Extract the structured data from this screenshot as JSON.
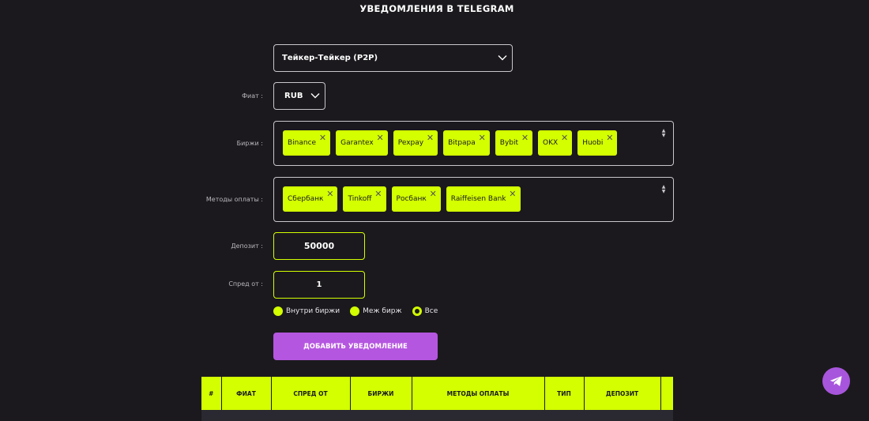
{
  "header": {
    "title": "УВЕДОМЛЕНИЯ В TELEGRAM"
  },
  "mode_select": {
    "value": "Тейкер-Тейкер (P2P)"
  },
  "fiat": {
    "label": "Фиат :",
    "value": "RUB"
  },
  "exchanges": {
    "label": "Биржи :",
    "tags": [
      "Binance",
      "Garantex",
      "Pexpay",
      "Bitpapa",
      "Bybit",
      "OKX",
      "Huobi"
    ]
  },
  "payment_methods": {
    "label": "Методы оплаты :",
    "tags": [
      "Сбербанк",
      "Tinkoff",
      "Росбанк",
      "Raiffeisen Bank"
    ]
  },
  "deposit": {
    "label": "Депозит :",
    "value": "50000"
  },
  "spread": {
    "label": "Спред от :",
    "value": "1"
  },
  "scope": {
    "options": [
      "Внутри биржи",
      "Меж бирж",
      "Все"
    ],
    "selected": "Все"
  },
  "add_button": {
    "label": "ДОБАВИТЬ УВЕДОМЛЕНИЕ"
  },
  "table": {
    "columns": [
      "#",
      "ФИАТ",
      "СПРЕД ОТ",
      "БИРЖИ",
      "МЕТОДЫ ОПЛАТЫ",
      "ТИП",
      "ДЕПОЗИТ",
      ""
    ]
  },
  "colors": {
    "background": "#1b191d",
    "accent_lime": "#d3ff00",
    "accent_purple": "#b556e0",
    "border": "#c9c6cc"
  },
  "icons": {
    "select_chevron": "chevron-down-icon",
    "tag_remove": "close-icon",
    "list_toggle": "updown-arrows-icon",
    "fab": "telegram-icon"
  }
}
